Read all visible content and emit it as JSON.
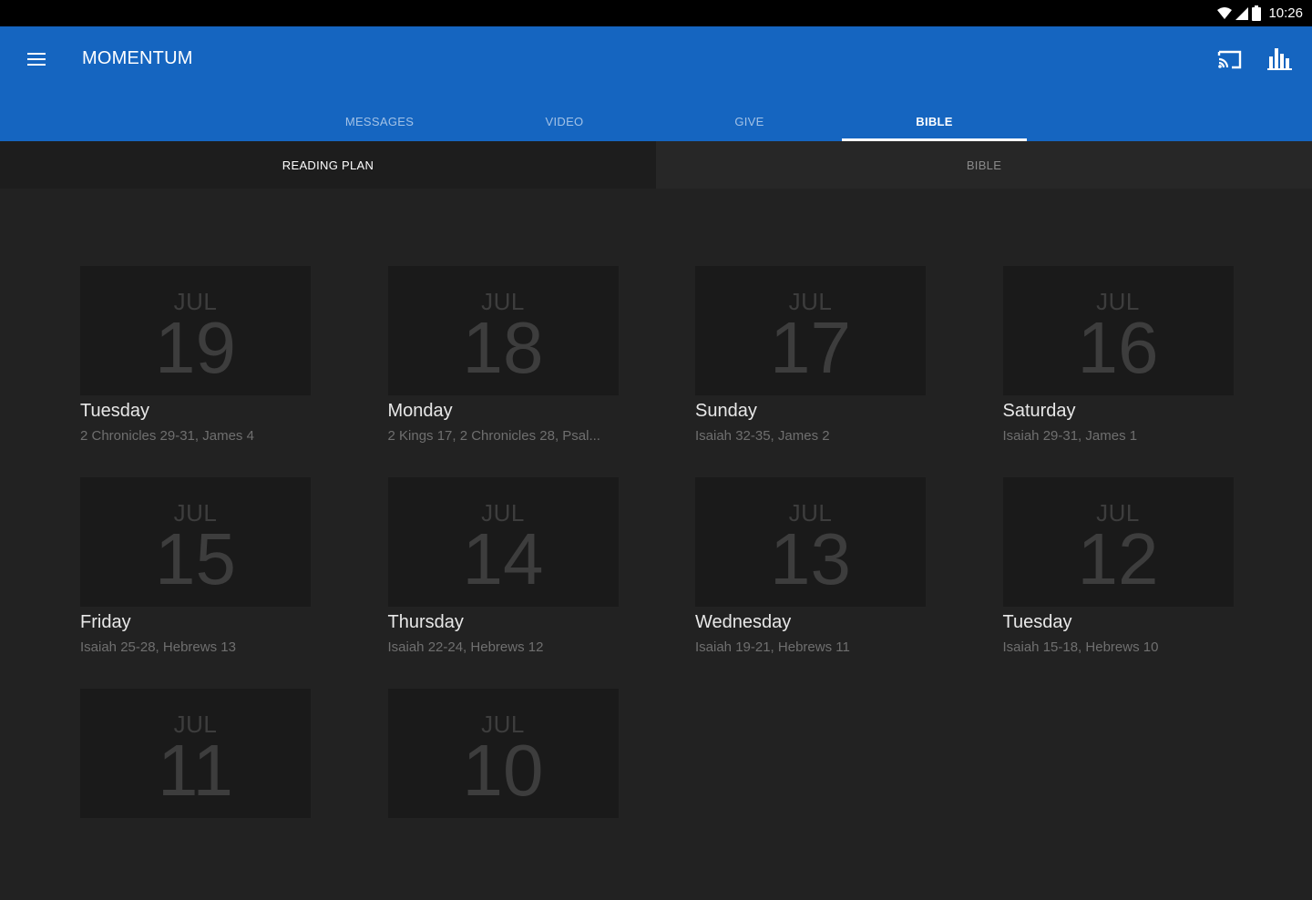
{
  "status_bar": {
    "time": "10:26"
  },
  "app_bar": {
    "title": "MOMENTUM",
    "tabs": [
      {
        "label": "MESSAGES"
      },
      {
        "label": "VIDEO"
      },
      {
        "label": "GIVE"
      },
      {
        "label": "BIBLE",
        "active": true
      }
    ]
  },
  "sub_tabs": [
    {
      "label": "READING PLAN",
      "active": true
    },
    {
      "label": "BIBLE",
      "active": false
    }
  ],
  "readings": [
    {
      "month": "JUL",
      "day": "19",
      "weekday": "Tuesday",
      "passage": "2 Chronicles 29-31, James 4"
    },
    {
      "month": "JUL",
      "day": "18",
      "weekday": "Monday",
      "passage": "2 Kings 17, 2 Chronicles 28, Psal..."
    },
    {
      "month": "JUL",
      "day": "17",
      "weekday": "Sunday",
      "passage": "Isaiah 32-35, James 2"
    },
    {
      "month": "JUL",
      "day": "16",
      "weekday": "Saturday",
      "passage": "Isaiah 29-31, James 1"
    },
    {
      "month": "JUL",
      "day": "15",
      "weekday": "Friday",
      "passage": "Isaiah 25-28, Hebrews 13"
    },
    {
      "month": "JUL",
      "day": "14",
      "weekday": "Thursday",
      "passage": "Isaiah 22-24, Hebrews 12"
    },
    {
      "month": "JUL",
      "day": "13",
      "weekday": "Wednesday",
      "passage": "Isaiah 19-21, Hebrews 11"
    },
    {
      "month": "JUL",
      "day": "12",
      "weekday": "Tuesday",
      "passage": "Isaiah 15-18, Hebrews 10"
    },
    {
      "month": "JUL",
      "day": "11",
      "weekday": "",
      "passage": ""
    },
    {
      "month": "JUL",
      "day": "10",
      "weekday": "",
      "passage": ""
    }
  ],
  "icons": {
    "menu": "hamburger-menu-icon",
    "cast": "cast-icon",
    "stats": "bar-chart-icon",
    "wifi": "wifi-icon",
    "signal": "cell-signal-icon",
    "battery": "battery-icon"
  },
  "colors": {
    "app_bar": "#1565c0",
    "background": "#222222",
    "tile": "#1a1a1a"
  }
}
